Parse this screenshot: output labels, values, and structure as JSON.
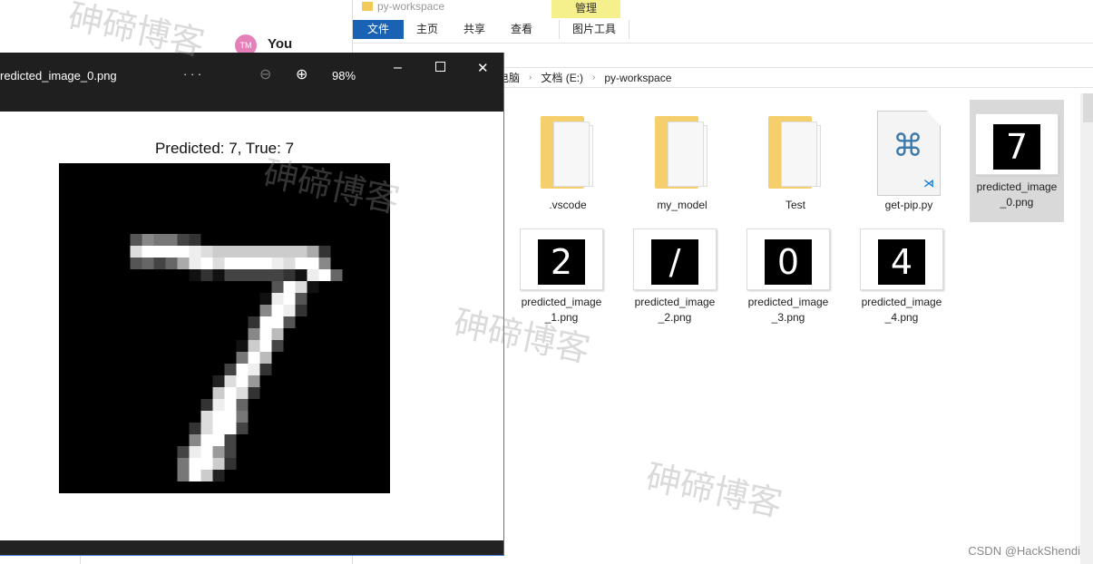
{
  "chat": {
    "avatar_initials": "TM",
    "user_name": "You"
  },
  "explorer": {
    "title": "py-workspace",
    "context_tab": "管理",
    "ribbon_tabs": [
      "文件",
      "主页",
      "共享",
      "查看",
      "图片工具"
    ],
    "breadcrumb": [
      "电脑",
      "文档 (E:)",
      "py-workspace"
    ],
    "items": [
      {
        "name": ".vscode",
        "type": "folder"
      },
      {
        "name": "my_model",
        "type": "folder"
      },
      {
        "name": "Test",
        "type": "folder"
      },
      {
        "name": "get-pip.py",
        "type": "python-file"
      },
      {
        "name": "predicted_image_0.png",
        "type": "image",
        "digit": "7",
        "selected": true
      },
      {
        "name": "predicted_image_1.png",
        "type": "image",
        "digit": "2"
      },
      {
        "name": "predicted_image_2.png",
        "type": "image",
        "digit": "/"
      },
      {
        "name": "predicted_image_3.png",
        "type": "image",
        "digit": "0"
      },
      {
        "name": "predicted_image_4.png",
        "type": "image",
        "digit": "4"
      }
    ]
  },
  "viewer": {
    "filename": "redicted_image_0.png",
    "more": "· · ·",
    "zoom": "98%",
    "caption": "Predicted: 7, True: 7"
  },
  "watermark": "砷碲博客",
  "credit": "CSDN @HackShendi",
  "colors": {
    "ribbon_active": "#1a62b3",
    "context_tab": "#f6f08c",
    "viewer_titlebar": "#1f1f1f"
  }
}
